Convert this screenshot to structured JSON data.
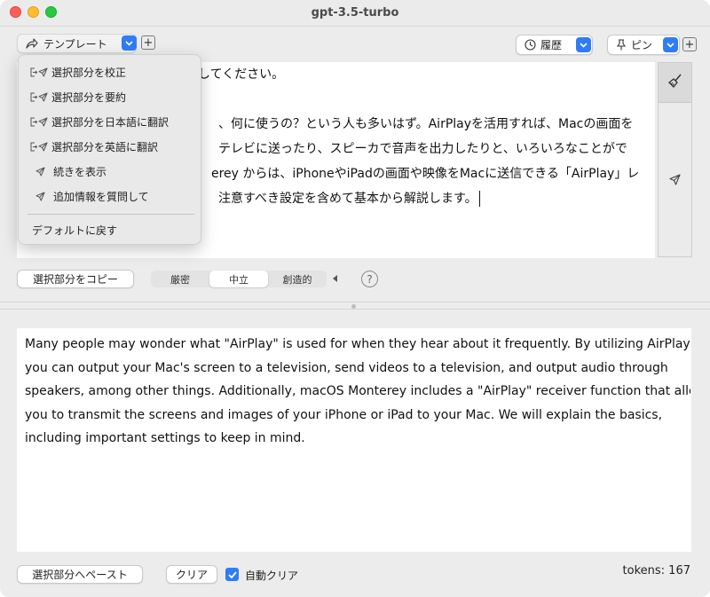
{
  "window": {
    "title": "gpt-3.5-turbo"
  },
  "toolbar": {
    "template_label": "テンプレート",
    "history_label": "履歴",
    "pin_label": "ピン"
  },
  "template_menu": {
    "items": [
      {
        "label": "選択部分を校正",
        "icon": "insert-send-icon"
      },
      {
        "label": "選択部分を要約",
        "icon": "insert-send-icon"
      },
      {
        "label": "選択部分を日本語に翻訳",
        "icon": "insert-send-icon"
      },
      {
        "label": "選択部分を英語に翻訳",
        "icon": "insert-send-icon"
      },
      {
        "label": "続きを表示",
        "icon": "send-icon"
      },
      {
        "label": "追加情報を質問して",
        "icon": "send-icon"
      }
    ],
    "reset_label": "デフォルトに戻す"
  },
  "prompt": {
    "lines": [
      "してください。",
      "",
      "、何に使うの？という人も多いはず。AirPlayを活用すれば、Macの画面を",
      "テレビに送ったり、スピーカで音声を出力したりと、いろいろなことがで",
      "erey からは、iPhoneやiPadの画面や映像をMacに送信できる「AirPlay」レ",
      "注意すべき設定を含めて基本から解説します。"
    ]
  },
  "controls": {
    "copy_selection_label": "選択部分をコピー",
    "temperature_options": [
      "厳密",
      "中立",
      "創造的"
    ],
    "temperature_selected": "中立",
    "help_label": "?"
  },
  "response": {
    "lines": [
      "Many people may wonder what \"AirPlay\" is used for when they hear about it frequently. By utilizing AirPlay,",
      "you can output your Mac's screen to a television, send videos to a television, and output audio through",
      "speakers, among other things. Additionally, macOS Monterey includes a \"AirPlay\" receiver function that allows",
      "you to transmit the screens and images of your iPhone or iPad to your Mac. We will explain the basics,",
      "including important settings to keep in mind."
    ]
  },
  "footer": {
    "paste_label": "選択部分へペースト",
    "clear_label": "クリア",
    "auto_clear_label": "自動クリア",
    "auto_clear_checked": true,
    "tokens_text": "tokens: 167"
  },
  "colors": {
    "accent": "#2f7cf6"
  }
}
